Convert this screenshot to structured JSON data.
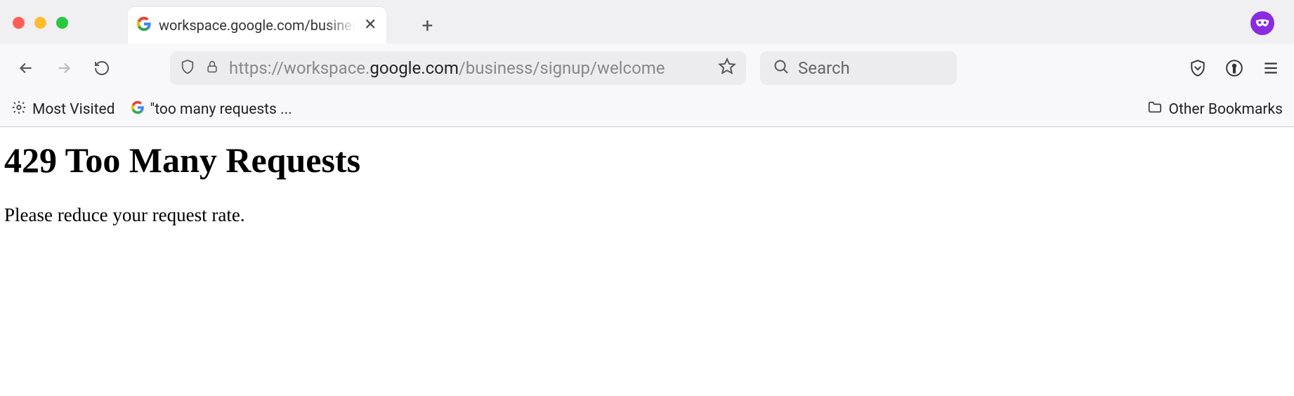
{
  "tab": {
    "title": "workspace.google.com/business"
  },
  "url": {
    "prefix": "https://workspace.",
    "domain": "google.com",
    "path": "/business/signup/welcome"
  },
  "search": {
    "placeholder": "Search"
  },
  "bookmarks": {
    "most_visited": "Most Visited",
    "too_many": "\"too many requests ...",
    "other": "Other Bookmarks"
  },
  "page": {
    "heading": "429 Too Many Requests",
    "message": "Please reduce your request rate."
  }
}
